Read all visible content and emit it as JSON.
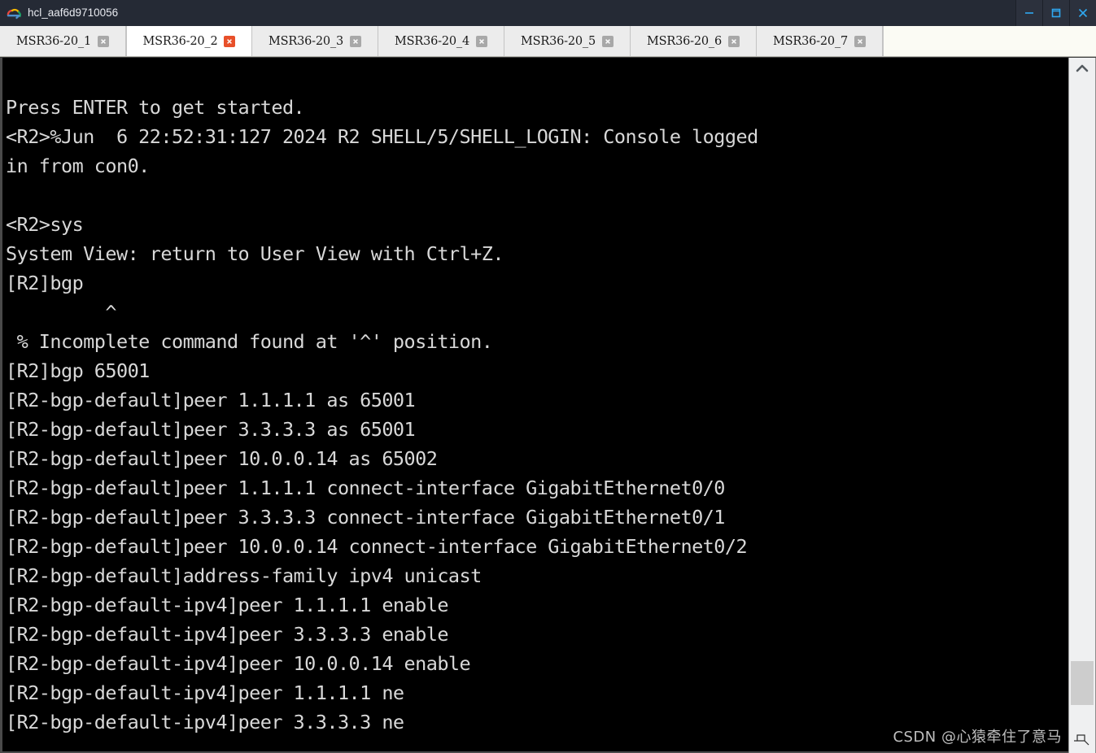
{
  "window": {
    "title": "hcl_aaf6d9710056",
    "logo_icon": "cloud-icon",
    "controls": {
      "minimize": "minimize-icon",
      "maximize": "maximize-icon",
      "close": "close-icon"
    },
    "accent_color": "#2fa8f0",
    "titlebar_color": "#252a35"
  },
  "tabs": [
    {
      "label": "MSR36-20_1",
      "active": false,
      "close_icon": "tab-close-icon"
    },
    {
      "label": "MSR36-20_2",
      "active": true,
      "close_icon": "tab-close-icon"
    },
    {
      "label": "MSR36-20_3",
      "active": false,
      "close_icon": "tab-close-icon"
    },
    {
      "label": "MSR36-20_4",
      "active": false,
      "close_icon": "tab-close-icon"
    },
    {
      "label": "MSR36-20_5",
      "active": false,
      "close_icon": "tab-close-icon"
    },
    {
      "label": "MSR36-20_6",
      "active": false,
      "close_icon": "tab-close-icon"
    },
    {
      "label": "MSR36-20_7",
      "active": false,
      "close_icon": "tab-close-icon"
    }
  ],
  "terminal": {
    "foreground": "#d8d8d8",
    "background": "#000000",
    "lines": [
      "Press ENTER to get started.",
      "<R2>%Jun  6 22:52:31:127 2024 R2 SHELL/5/SHELL_LOGIN: Console logged",
      "in from con0.",
      "",
      "<R2>sys",
      "System View: return to User View with Ctrl+Z.",
      "[R2]bgp",
      "         ^",
      " % Incomplete command found at '^' position.",
      "[R2]bgp 65001",
      "[R2-bgp-default]peer 1.1.1.1 as 65001",
      "[R2-bgp-default]peer 3.3.3.3 as 65001",
      "[R2-bgp-default]peer 10.0.0.14 as 65002",
      "[R2-bgp-default]peer 1.1.1.1 connect-interface GigabitEthernet0/0",
      "[R2-bgp-default]peer 3.3.3.3 connect-interface GigabitEthernet0/1",
      "[R2-bgp-default]peer 10.0.0.14 connect-interface GigabitEthernet0/2",
      "[R2-bgp-default]address-family ipv4 unicast",
      "[R2-bgp-default-ipv4]peer 1.1.1.1 enable",
      "[R2-bgp-default-ipv4]peer 3.3.3.3 enable",
      "[R2-bgp-default-ipv4]peer 10.0.0.14 enable",
      "[R2-bgp-default-ipv4]peer 1.1.1.1 ne",
      "[R2-bgp-default-ipv4]peer 3.3.3.3 ne"
    ]
  },
  "scrollbar": {
    "up_arrow_icon": "chevron-up-icon",
    "resize_grip_icon": "resize-grip-icon"
  },
  "watermark": {
    "text": "CSDN @心猿牵住了意马"
  }
}
